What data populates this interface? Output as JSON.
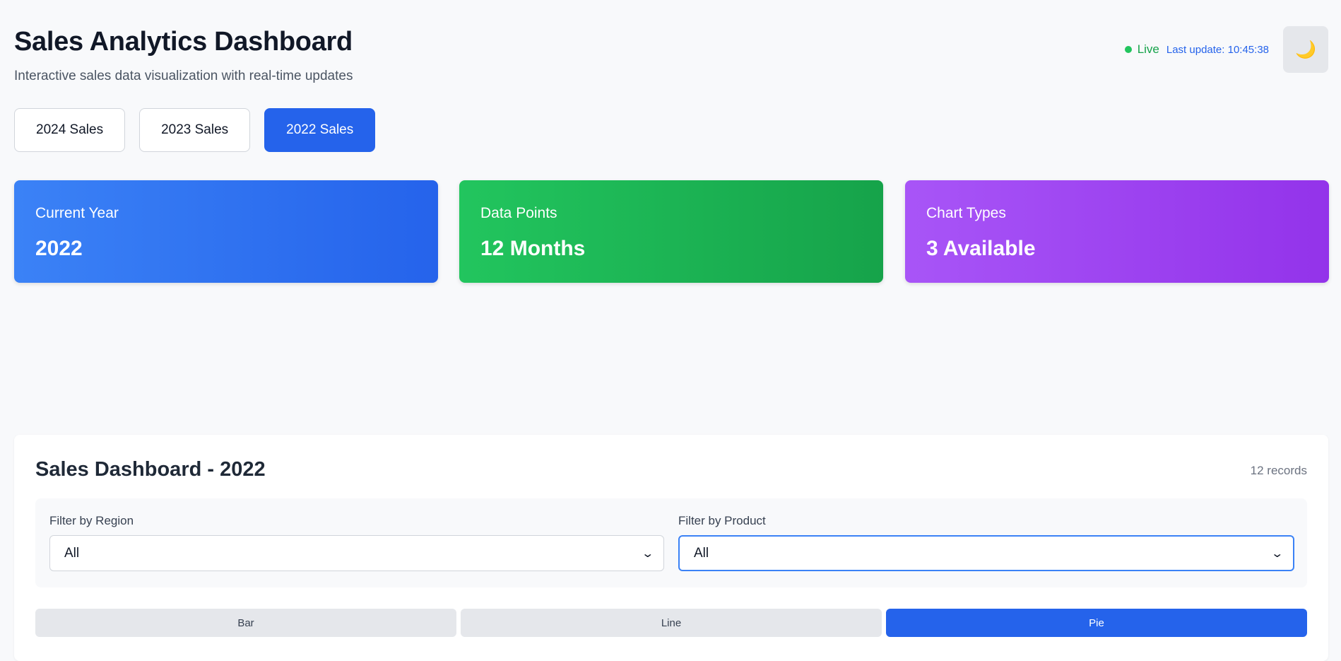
{
  "header": {
    "title": "Sales Analytics Dashboard",
    "subtitle": "Interactive sales data visualization with real-time updates",
    "live_label": "Live",
    "last_update": "Last update: 10:45:38",
    "theme_icon": "moon-icon",
    "theme_glyph": "🌙"
  },
  "year_tabs": [
    {
      "label": "2024 Sales",
      "active": false
    },
    {
      "label": "2023 Sales",
      "active": false
    },
    {
      "label": "2022 Sales",
      "active": true
    }
  ],
  "stats": [
    {
      "label": "Current Year",
      "value": "2022",
      "color": "#3b82f6"
    },
    {
      "label": "Data Points",
      "value": "12 Months",
      "color": "#22c55e"
    },
    {
      "label": "Chart Types",
      "value": "3 Available",
      "color": "#a855f7"
    }
  ],
  "panel": {
    "title": "Sales Dashboard - 2022",
    "record_count": "12 records",
    "filters": {
      "region": {
        "label": "Filter by Region",
        "value": "All"
      },
      "product": {
        "label": "Filter by Product",
        "value": "All"
      }
    },
    "chart_tabs": [
      {
        "label": "Bar",
        "active": false
      },
      {
        "label": "Line",
        "active": false
      },
      {
        "label": "Pie",
        "active": true
      }
    ]
  },
  "colors": {
    "accent": "#2563eb",
    "live": "#22c55e",
    "background": "#f8f9fb"
  }
}
